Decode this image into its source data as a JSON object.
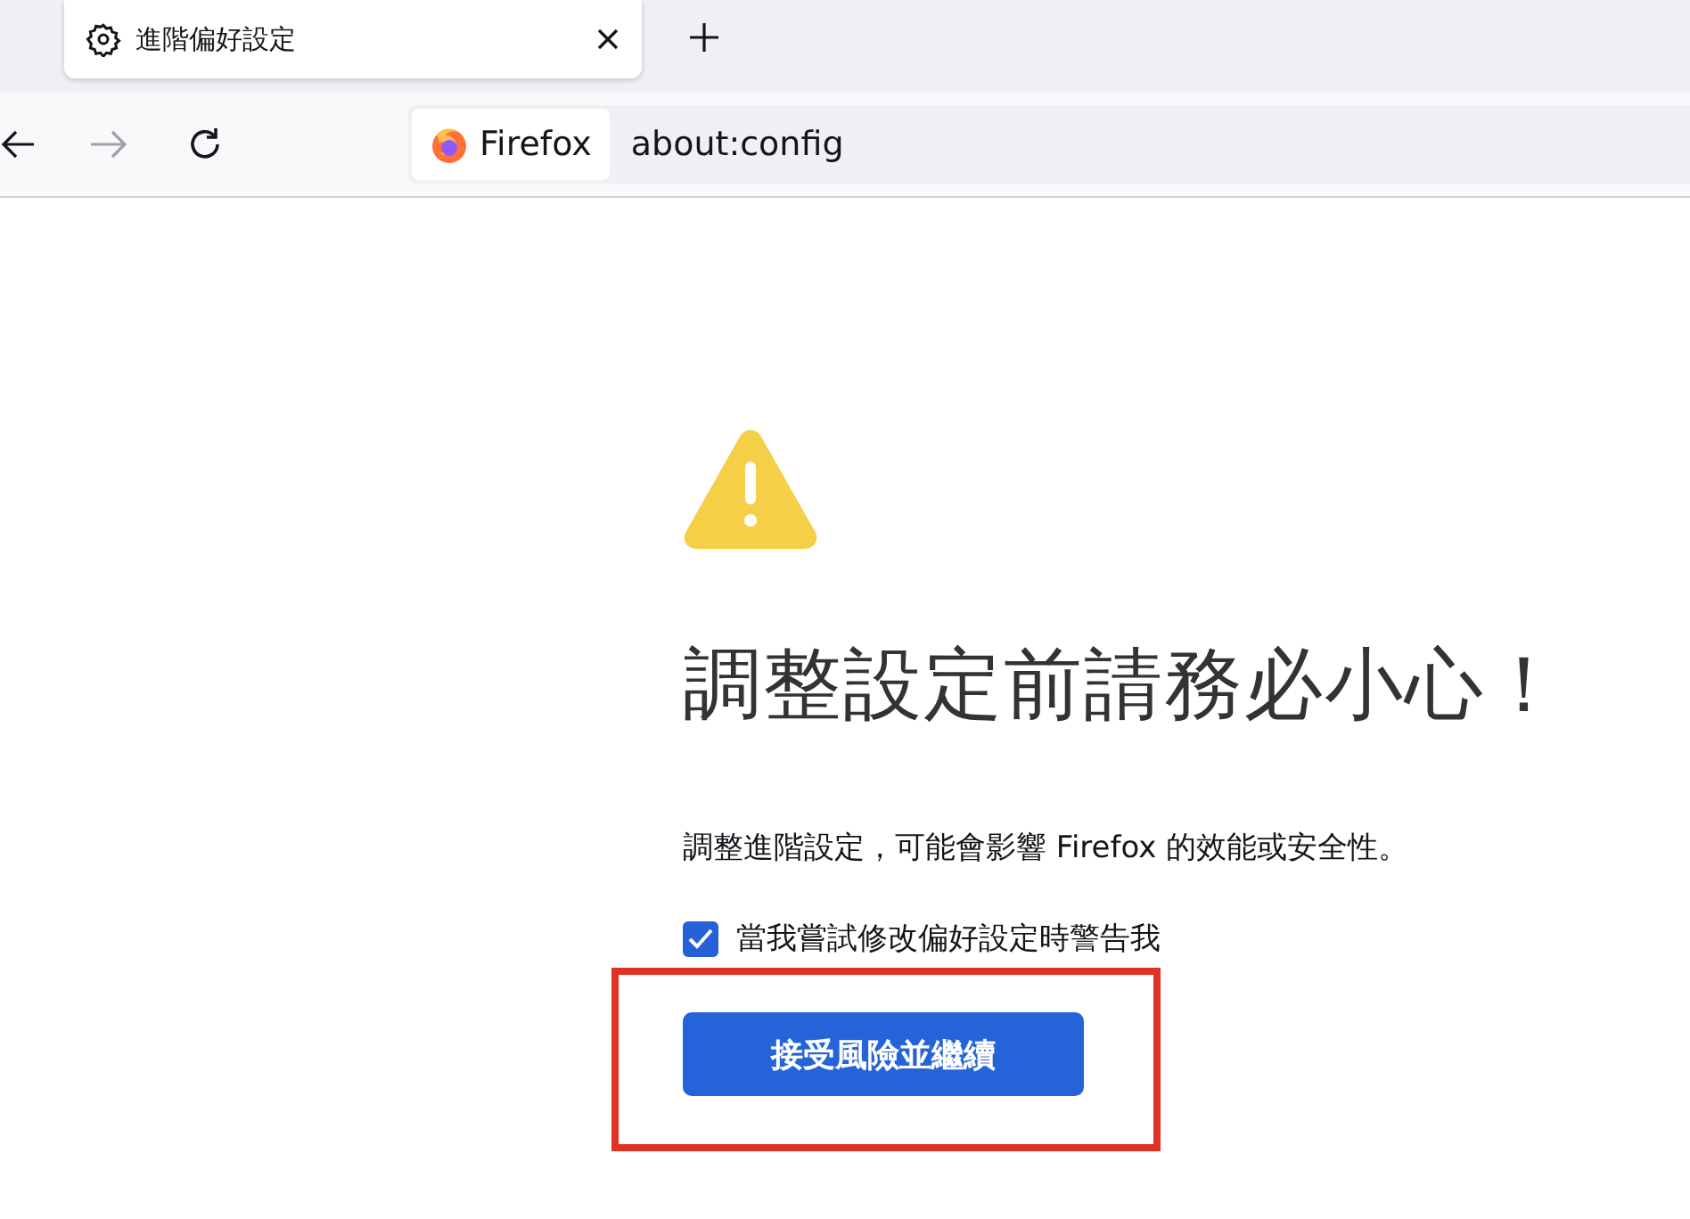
{
  "tab": {
    "title": "進階偏好設定",
    "selected": true
  },
  "url_bar": {
    "identity": "Firefox",
    "address": "about:config"
  },
  "warning": {
    "title": "調整設定前請務必小心！",
    "description": "調整進階設定，可能會影響 Firefox 的效能或安全性。",
    "checkbox": {
      "label": "當我嘗試修改偏好設定時警告我",
      "checked": true
    },
    "button": {
      "label": "接受風險並繼續",
      "highlighted": true
    }
  }
}
